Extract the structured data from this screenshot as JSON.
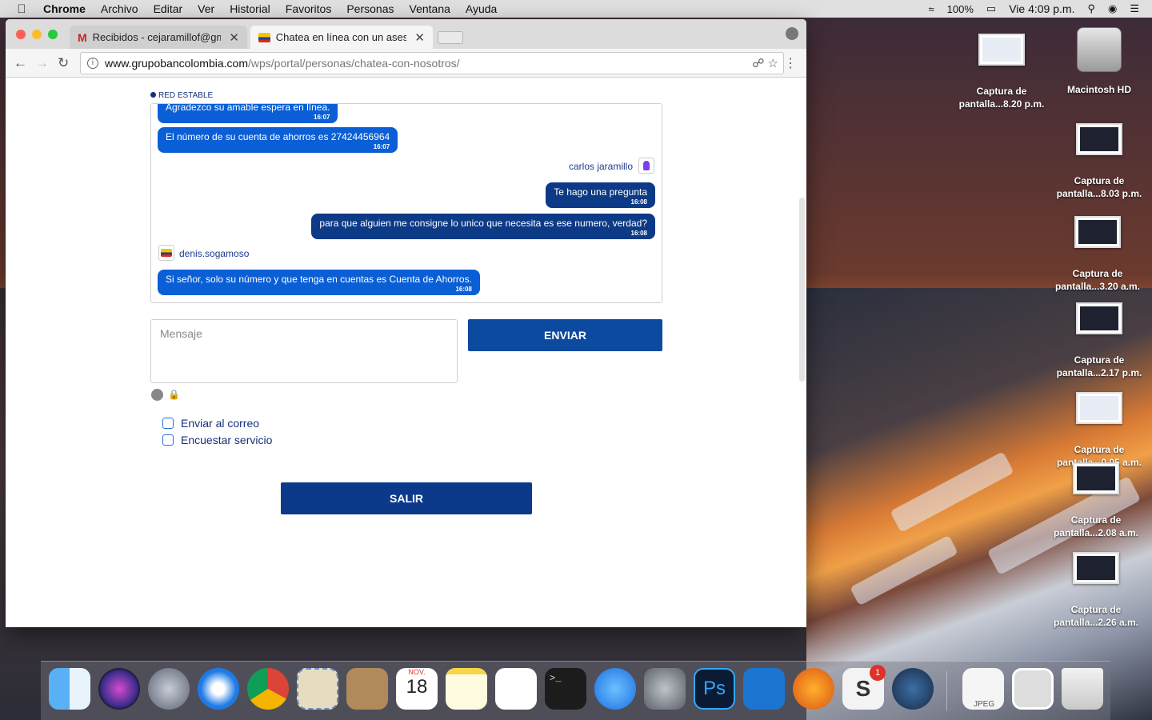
{
  "menubar": {
    "app": "Chrome",
    "items": [
      "Archivo",
      "Editar",
      "Ver",
      "Historial",
      "Favoritos",
      "Personas",
      "Ventana",
      "Ayuda"
    ],
    "battery": "100%",
    "clock": "Vie 4:09 p.m."
  },
  "browser": {
    "tabs": [
      {
        "label": "Recibidos - cejaramillof@gmail",
        "icon": "gmail-icon"
      },
      {
        "label": "Chatea en línea con un asesor",
        "icon": "bancolombia-icon"
      }
    ],
    "url_host": "www.grupobancolombia.com",
    "url_path": "/wps/portal/personas/chatea-con-nosotros/"
  },
  "chat": {
    "status": "RED ESTABLE",
    "messages": [
      {
        "text": "Agradezco su amable espera en línea.",
        "time": "16:07"
      },
      {
        "text": "El número de su cuenta de ahorros es 27424456964",
        "time": "16:07"
      },
      {
        "text": "Te hago una pregunta",
        "time": "16:08"
      },
      {
        "text": "para que alguien me consigne lo unico que necesita es ese numero, verdad?",
        "time": "16:08"
      },
      {
        "text": "Si señor, solo su número y que tenga en cuentas es Cuenta de Ahorros.",
        "time": "16:08"
      }
    ],
    "user_name": "carlos jaramillo",
    "agent_name": "denis.sogamoso",
    "message_placeholder": "Mensaje",
    "send_label": "ENVIAR",
    "email_option": "Enviar al correo",
    "survey_option": "Encuestar servicio",
    "exit_label": "SALIR"
  },
  "desktop": {
    "icons": [
      {
        "line1": "Captura de",
        "line2": "pantalla...8.20 p.m."
      },
      {
        "line1": "Macintosh HD",
        "line2": ""
      },
      {
        "line1": "Captura de",
        "line2": "pantalla...8.03 p.m."
      },
      {
        "line1": "Captura de",
        "line2": "pantalla...3.20 a.m."
      },
      {
        "line1": "Captura de",
        "line2": "pantalla...2.17 p.m."
      },
      {
        "line1": "Captura de",
        "line2": "pantalla...0.05 a.m."
      },
      {
        "line1": "Captura de",
        "line2": "pantalla...2.08 a.m."
      },
      {
        "line1": "Captura de",
        "line2": "pantalla...2.26 a.m."
      }
    ]
  },
  "dock": {
    "calendar_month": "NOV.",
    "calendar_day": "18",
    "badge": "1",
    "jpeg_label": "JPEG",
    "apps": [
      "finder-icon",
      "siri-icon",
      "launchpad-icon",
      "safari-icon",
      "chrome-icon",
      "mail-icon",
      "contacts-icon",
      "calendar-icon",
      "notes-icon",
      "reminders-icon",
      "terminal-icon",
      "app-store-icon",
      "system-preferences-icon",
      "photoshop-icon",
      "brackets-icon",
      "transmit-icon",
      "slack-icon",
      "steam-icon",
      "jpeg-file-icon",
      "photo-icon",
      "trash-icon"
    ]
  }
}
